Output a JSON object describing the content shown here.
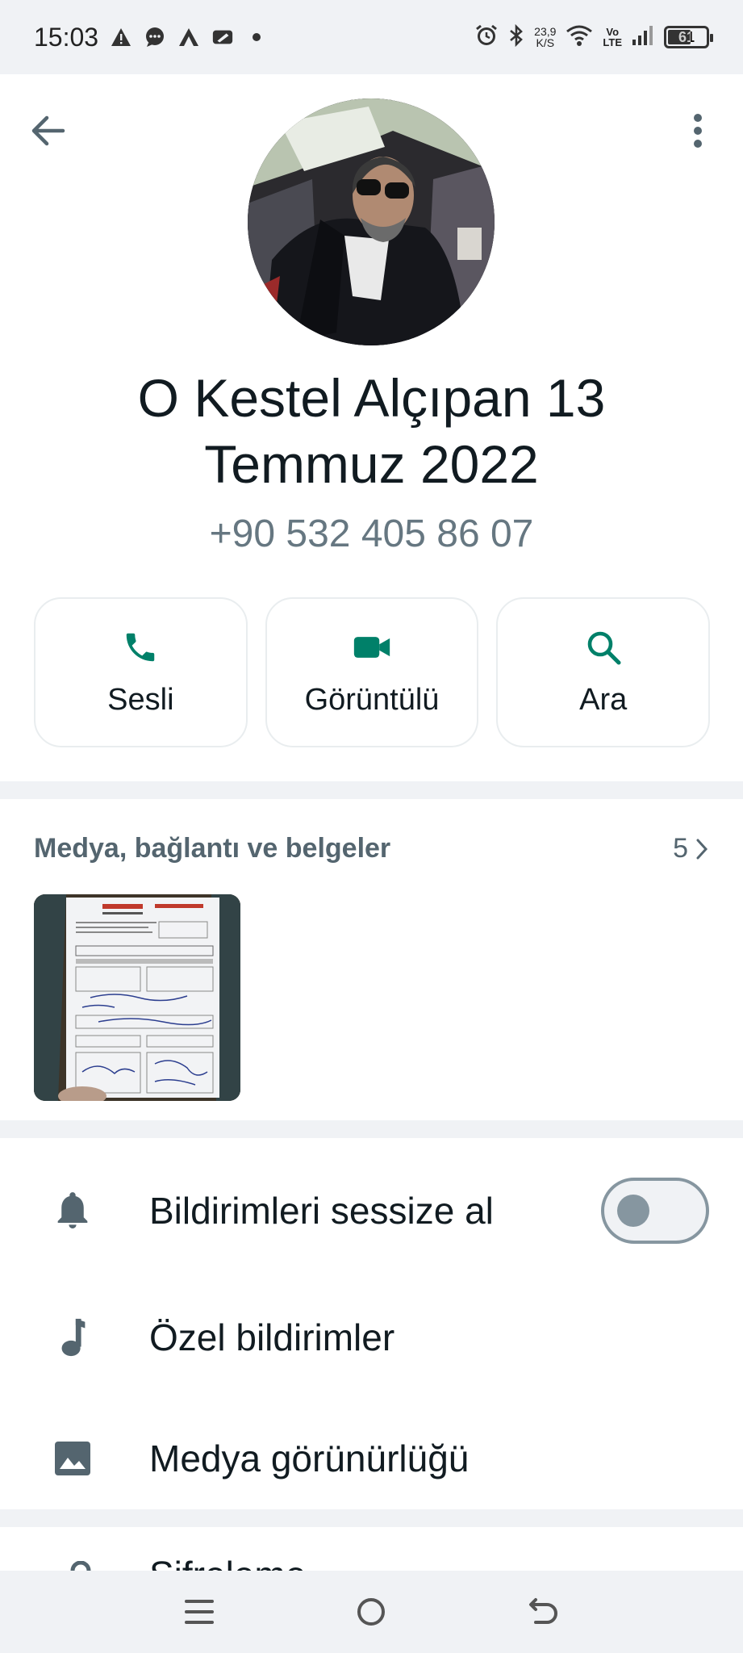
{
  "status_bar": {
    "time": "15:03",
    "speed_value": "23,9",
    "speed_unit": "K/S",
    "volte_top": "Vo",
    "volte_bottom": "LTE",
    "battery": "61",
    "battery_level": 0.61
  },
  "profile": {
    "name": "O Kestel Alçıpan 13 Temmuz 2022",
    "phone": "+90 532 405 86 07"
  },
  "actions": [
    {
      "label": "Sesli",
      "icon": "phone-icon"
    },
    {
      "label": "Görüntülü",
      "icon": "video-icon"
    },
    {
      "label": "Ara",
      "icon": "search-icon"
    }
  ],
  "media": {
    "title": "Medya, bağlantı ve belgeler",
    "count": "5"
  },
  "settings": [
    {
      "label": "Bildirimleri sessize al",
      "icon": "bell-icon",
      "toggle": false
    },
    {
      "label": "Özel bildirimler",
      "icon": "music-note-icon"
    },
    {
      "label": "Medya görünürlüğü",
      "icon": "image-icon"
    }
  ],
  "partial_setting": {
    "label": "Şifreleme"
  },
  "colors": {
    "accent": "#008069",
    "muted": "#667781",
    "background": "#f0f2f5"
  }
}
